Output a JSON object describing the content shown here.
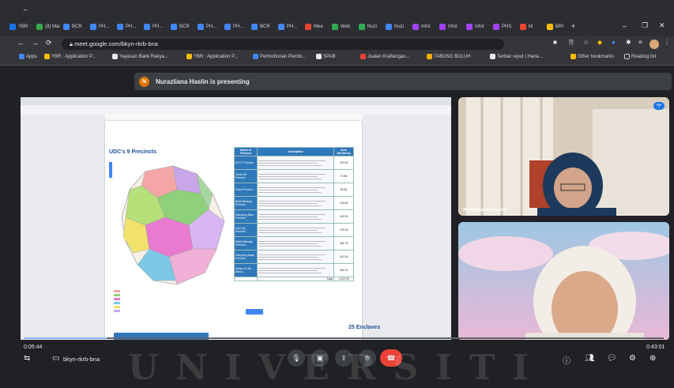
{
  "browser": {
    "tabs": [
      {
        "label": "YBR :",
        "color": "#1a73e8"
      },
      {
        "label": "(8) Mail",
        "color": "#34a853"
      },
      {
        "label": "BCR",
        "color": "#4285f4"
      },
      {
        "label": "PH...",
        "color": "#4285f4"
      },
      {
        "label": "PH...",
        "color": "#4285f4"
      },
      {
        "label": "PH...",
        "color": "#4285f4"
      },
      {
        "label": "BCR",
        "color": "#4285f4"
      },
      {
        "label": "PH...",
        "color": "#4285f4"
      },
      {
        "label": "PH...",
        "color": "#4285f4"
      },
      {
        "label": "BCR",
        "color": "#4285f4"
      },
      {
        "label": "PH...",
        "color": "#4285f4"
      },
      {
        "label": "Mee",
        "color": "#ea4335"
      },
      {
        "label": "Web",
        "color": "#34a853"
      },
      {
        "label": "Nuzi",
        "color": "#34a853"
      },
      {
        "label": "Nuzi",
        "color": "#4285f4"
      },
      {
        "label": "Infot",
        "color": "#a142f4"
      },
      {
        "label": "Infot",
        "color": "#a142f4"
      },
      {
        "label": "Infot",
        "color": "#a142f4"
      },
      {
        "label": "PHS",
        "color": "#a142f4"
      },
      {
        "label": "M",
        "color": "#ea4335"
      },
      {
        "label": "BRI",
        "color": "#fbbc04"
      }
    ],
    "address": "meet.google.com/bkyn-rkrb-bna",
    "bookmarks": [
      {
        "label": "Apps",
        "color": "#4285f4"
      },
      {
        "label": "YBR : Application P...",
        "color": "#fbbc04"
      },
      {
        "label": "Yayasan Bank Rakya...",
        "color": "#e8eaed"
      },
      {
        "label": "YBR : Application P...",
        "color": "#fbbc04"
      },
      {
        "label": "Permohonan Pembi...",
        "color": "#4285f4"
      },
      {
        "label": "SPAB",
        "color": "#e8eaed"
      },
      {
        "label": "Jualan Kraftangan...",
        "color": "#ea4335"
      },
      {
        "label": "TABUNG BULUH",
        "color": "#f9ab00"
      },
      {
        "label": "Terbiar reput | Haria...",
        "color": "#e8eaed"
      }
    ],
    "other_bookmarks": "Other bookmarks",
    "reading_list": "Reading list"
  },
  "meet": {
    "presenting_initial": "N",
    "presenting_text": "Nurazliana Haslin is presenting",
    "participant1_name": "Nurazliana Haslin",
    "participant2_name": "",
    "elapsed": "0:05:44",
    "total": "0:43:01",
    "meeting_code": "bkyn-rkrb-bna",
    "progress_fraction": 0.13
  },
  "shared_doc": {
    "title": "UDC's 9 Precincts",
    "table_headers": [
      "Name of Precinct",
      "Description",
      "Area (Hectares)"
    ],
    "rows": [
      {
        "name": "ACTC Precinct",
        "area": "150.65"
      },
      {
        "name": "Chow Kit Precinct",
        "area": "73.88"
      },
      {
        "name": "Pudu Precinct",
        "area": "59.55"
      },
      {
        "name": "Bukit Bintang Precinct",
        "area": "225.84"
      },
      {
        "name": "Kampung Baru Precinct",
        "area": "150.35"
      },
      {
        "name": "Old City Precinct",
        "area": "193.05"
      },
      {
        "name": "Rakit Mahraja Precinct",
        "area": "256.76"
      },
      {
        "name": "Kampung Attap Precinct",
        "area": "160.26"
      },
      {
        "name": "Mines of Life (MOL)",
        "area": "286.49"
      }
    ],
    "total_label": "Total",
    "total_value": "1,649.05",
    "enclaves": "25 Enclaves"
  },
  "watermark": "UNIVERSITI"
}
